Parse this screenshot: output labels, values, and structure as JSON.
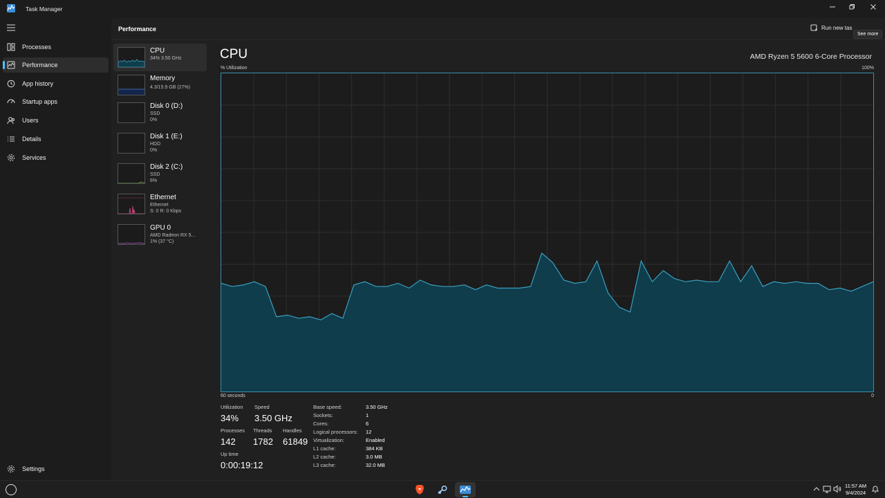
{
  "window": {
    "title": "Task Manager"
  },
  "nav": {
    "items": [
      {
        "label": "Processes"
      },
      {
        "label": "Performance"
      },
      {
        "label": "App history"
      },
      {
        "label": "Startup apps"
      },
      {
        "label": "Users"
      },
      {
        "label": "Details"
      },
      {
        "label": "Services"
      }
    ],
    "settings_label": "Settings",
    "active_index": 1
  },
  "header": {
    "title": "Performance",
    "run_new_task": "Run new tas",
    "tooltip": "See more"
  },
  "devices": [
    {
      "name": "CPU",
      "line1": "34% 3.50 GHz",
      "line2": ""
    },
    {
      "name": "Memory",
      "line1": "4.3/15.9 GB (27%)",
      "line2": ""
    },
    {
      "name": "Disk 0 (D:)",
      "line1": "SSD",
      "line2": "0%"
    },
    {
      "name": "Disk 1 (E:)",
      "line1": "HDD",
      "line2": "0%"
    },
    {
      "name": "Disk 2 (C:)",
      "line1": "SSD",
      "line2": "6%"
    },
    {
      "name": "Ethernet",
      "line1": "Ethernet",
      "line2": "S: 0 R: 0 Kbps"
    },
    {
      "name": "GPU 0",
      "line1": "AMD Radeon RX 5...",
      "line2": "1% (37 °C)"
    }
  ],
  "cpu": {
    "title": "CPU",
    "model": "AMD Ryzen 5 5600 6-Core Processor",
    "util_label": "% Utilization",
    "max_label": "100%",
    "time_label": "60 seconds",
    "zero_label": "0",
    "history": [
      34,
      33,
      33.5,
      34.5,
      33,
      23.5,
      24,
      23,
      23.5,
      22.5,
      24.5,
      23,
      33.5,
      34.5,
      33,
      33,
      34,
      32.5,
      35,
      33.5,
      33,
      33,
      33.5,
      32,
      33.5,
      32.5,
      32.5,
      32.5,
      33,
      43.5,
      40.5,
      35,
      34,
      34.5,
      41,
      31,
      26.5,
      25,
      41,
      34.5,
      38,
      35.5,
      34.5,
      35,
      34.5,
      34.5,
      41,
      34.5,
      39.5,
      33,
      34.5,
      34,
      34.5,
      34,
      34,
      32,
      32.5,
      31.5,
      33,
      34.5
    ],
    "stats": {
      "utilization_label": "Utilization",
      "utilization": "34%",
      "speed_label": "Speed",
      "speed": "3.50 GHz",
      "processes_label": "Processes",
      "processes": "142",
      "threads_label": "Threads",
      "threads": "1782",
      "handles_label": "Handles",
      "handles": "61849",
      "uptime_label": "Up time",
      "uptime": "0:00:19:12"
    },
    "specs": [
      {
        "k": "Base speed:",
        "v": "3.50 GHz"
      },
      {
        "k": "Sockets:",
        "v": "1"
      },
      {
        "k": "Cores:",
        "v": "6"
      },
      {
        "k": "Logical processors:",
        "v": "12"
      },
      {
        "k": "Virtualization:",
        "v": "Enabled"
      },
      {
        "k": "L1 cache:",
        "v": "384 KB"
      },
      {
        "k": "L2 cache:",
        "v": "3.0 MB"
      },
      {
        "k": "L3 cache:",
        "v": "32.0 MB"
      }
    ]
  },
  "taskbar": {
    "time": "11:57 AM",
    "date": "9/4/2024",
    "apps": [
      "brave-browser",
      "steam",
      "task-manager"
    ]
  },
  "colors": {
    "accent": "#4cc2ff",
    "cpu_line": "#3a9fc0",
    "cpu_fill": "#0f3d4c",
    "memory_line": "#4a7ed8",
    "disk_line": "#7bc043",
    "ethernet_line": "#d0508a",
    "gpu_line": "#b25fc8"
  }
}
